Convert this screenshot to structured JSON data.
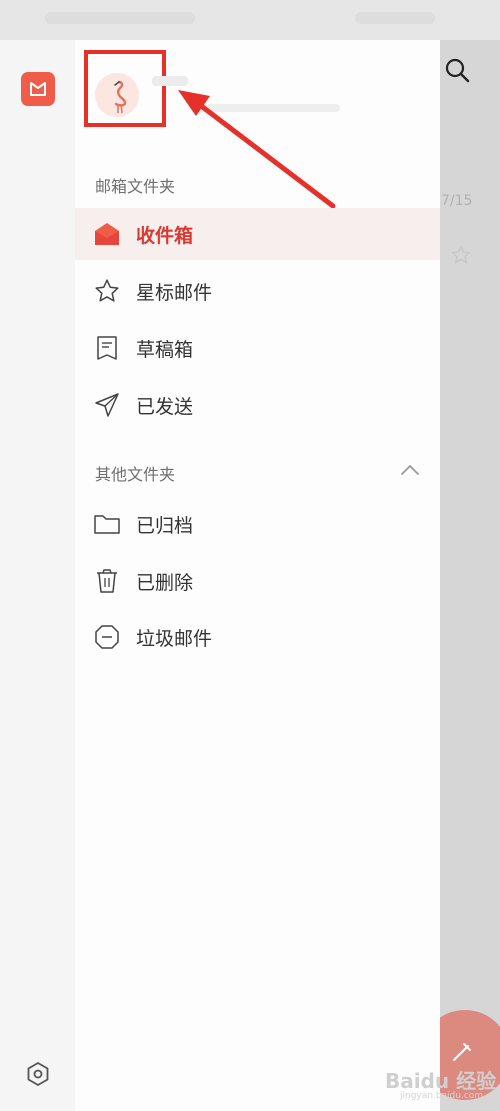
{
  "colors": {
    "accent": "#d83a31",
    "highlight_box": "#e5312a",
    "active_row_bg": "#f7eeee"
  },
  "background": {
    "list_date": "7/15"
  },
  "drawer": {
    "section_mailbox": "邮箱文件夹",
    "mailbox_items": [
      {
        "label": "收件箱",
        "icon": "inbox-icon",
        "active": true
      },
      {
        "label": "星标邮件",
        "icon": "star-icon",
        "active": false
      },
      {
        "label": "草稿箱",
        "icon": "draft-icon",
        "active": false
      },
      {
        "label": "已发送",
        "icon": "send-icon",
        "active": false
      }
    ],
    "section_other": "其他文件夹",
    "other_items": [
      {
        "label": "已归档",
        "icon": "folder-icon"
      },
      {
        "label": "已删除",
        "icon": "trash-icon"
      },
      {
        "label": "垃圾邮件",
        "icon": "spam-icon"
      }
    ]
  },
  "watermark": {
    "text": "Baidu 经验",
    "sub": "jingyan.baidu.com"
  }
}
